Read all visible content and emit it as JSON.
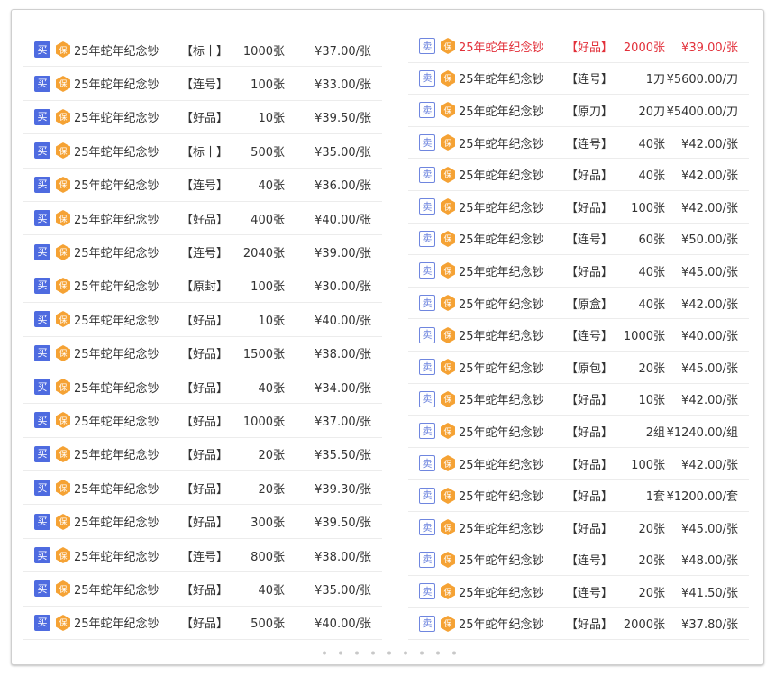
{
  "colors": {
    "buy_tag": "#4e6be0",
    "sell_tag": "#6f86df",
    "badge": "#f5a234",
    "highlight": "#e2303a"
  },
  "left_list": [
    {
      "tag": "买",
      "badge": "保",
      "name": "25年蛇年纪念钞",
      "cat": "【标十】",
      "qty": "1000张",
      "price": "¥37.00/张"
    },
    {
      "tag": "买",
      "badge": "保",
      "name": "25年蛇年纪念钞",
      "cat": "【连号】",
      "qty": "100张",
      "price": "¥33.00/张"
    },
    {
      "tag": "买",
      "badge": "保",
      "name": "25年蛇年纪念钞",
      "cat": "【好品】",
      "qty": "10张",
      "price": "¥39.50/张"
    },
    {
      "tag": "买",
      "badge": "保",
      "name": "25年蛇年纪念钞",
      "cat": "【标十】",
      "qty": "500张",
      "price": "¥35.00/张"
    },
    {
      "tag": "买",
      "badge": "保",
      "name": "25年蛇年纪念钞",
      "cat": "【连号】",
      "qty": "40张",
      "price": "¥36.00/张"
    },
    {
      "tag": "买",
      "badge": "保",
      "name": "25年蛇年纪念钞",
      "cat": "【好品】",
      "qty": "400张",
      "price": "¥40.00/张"
    },
    {
      "tag": "买",
      "badge": "保",
      "name": "25年蛇年纪念钞",
      "cat": "【连号】",
      "qty": "2040张",
      "price": "¥39.00/张"
    },
    {
      "tag": "买",
      "badge": "保",
      "name": "25年蛇年纪念钞",
      "cat": "【原封】",
      "qty": "100张",
      "price": "¥30.00/张"
    },
    {
      "tag": "买",
      "badge": "保",
      "name": "25年蛇年纪念钞",
      "cat": "【好品】",
      "qty": "10张",
      "price": "¥40.00/张"
    },
    {
      "tag": "买",
      "badge": "保",
      "name": "25年蛇年纪念钞",
      "cat": "【好品】",
      "qty": "1500张",
      "price": "¥38.00/张"
    },
    {
      "tag": "买",
      "badge": "保",
      "name": "25年蛇年纪念钞",
      "cat": "【好品】",
      "qty": "40张",
      "price": "¥34.00/张"
    },
    {
      "tag": "买",
      "badge": "保",
      "name": "25年蛇年纪念钞",
      "cat": "【好品】",
      "qty": "1000张",
      "price": "¥37.00/张"
    },
    {
      "tag": "买",
      "badge": "保",
      "name": "25年蛇年纪念钞",
      "cat": "【好品】",
      "qty": "20张",
      "price": "¥35.50/张"
    },
    {
      "tag": "买",
      "badge": "保",
      "name": "25年蛇年纪念钞",
      "cat": "【好品】",
      "qty": "20张",
      "price": "¥39.30/张"
    },
    {
      "tag": "买",
      "badge": "保",
      "name": "25年蛇年纪念钞",
      "cat": "【好品】",
      "qty": "300张",
      "price": "¥39.50/张"
    },
    {
      "tag": "买",
      "badge": "保",
      "name": "25年蛇年纪念钞",
      "cat": "【连号】",
      "qty": "800张",
      "price": "¥38.00/张"
    },
    {
      "tag": "买",
      "badge": "保",
      "name": "25年蛇年纪念钞",
      "cat": "【好品】",
      "qty": "40张",
      "price": "¥35.00/张"
    },
    {
      "tag": "买",
      "badge": "保",
      "name": "25年蛇年纪念钞",
      "cat": "【好品】",
      "qty": "500张",
      "price": "¥40.00/张"
    }
  ],
  "right_list": [
    {
      "tag": "卖",
      "badge": "保",
      "name": "25年蛇年纪念钞",
      "cat": "【好品】",
      "qty": "2000张",
      "price": "¥39.00/张",
      "highlight": true
    },
    {
      "tag": "卖",
      "badge": "保",
      "name": "25年蛇年纪念钞",
      "cat": "【连号】",
      "qty": "1刀",
      "price": "¥5600.00/刀"
    },
    {
      "tag": "卖",
      "badge": "保",
      "name": "25年蛇年纪念钞",
      "cat": "【原刀】",
      "qty": "20刀",
      "price": "¥5400.00/刀"
    },
    {
      "tag": "卖",
      "badge": "保",
      "name": "25年蛇年纪念钞",
      "cat": "【连号】",
      "qty": "40张",
      "price": "¥42.00/张"
    },
    {
      "tag": "卖",
      "badge": "保",
      "name": "25年蛇年纪念钞",
      "cat": "【好品】",
      "qty": "40张",
      "price": "¥42.00/张"
    },
    {
      "tag": "卖",
      "badge": "保",
      "name": "25年蛇年纪念钞",
      "cat": "【好品】",
      "qty": "100张",
      "price": "¥42.00/张"
    },
    {
      "tag": "卖",
      "badge": "保",
      "name": "25年蛇年纪念钞",
      "cat": "【连号】",
      "qty": "60张",
      "price": "¥50.00/张"
    },
    {
      "tag": "卖",
      "badge": "保",
      "name": "25年蛇年纪念钞",
      "cat": "【好品】",
      "qty": "40张",
      "price": "¥45.00/张"
    },
    {
      "tag": "卖",
      "badge": "保",
      "name": "25年蛇年纪念钞",
      "cat": "【原盒】",
      "qty": "40张",
      "price": "¥42.00/张"
    },
    {
      "tag": "卖",
      "badge": "保",
      "name": "25年蛇年纪念钞",
      "cat": "【连号】",
      "qty": "1000张",
      "price": "¥40.00/张"
    },
    {
      "tag": "卖",
      "badge": "保",
      "name": "25年蛇年纪念钞",
      "cat": "【原包】",
      "qty": "20张",
      "price": "¥45.00/张"
    },
    {
      "tag": "卖",
      "badge": "保",
      "name": "25年蛇年纪念钞",
      "cat": "【好品】",
      "qty": "10张",
      "price": "¥42.00/张"
    },
    {
      "tag": "卖",
      "badge": "保",
      "name": "25年蛇年纪念钞",
      "cat": "【好品】",
      "qty": "2组",
      "price": "¥1240.00/组"
    },
    {
      "tag": "卖",
      "badge": "保",
      "name": "25年蛇年纪念钞",
      "cat": "【好品】",
      "qty": "100张",
      "price": "¥42.00/张"
    },
    {
      "tag": "卖",
      "badge": "保",
      "name": "25年蛇年纪念钞",
      "cat": "【好品】",
      "qty": "1套",
      "price": "¥1200.00/套"
    },
    {
      "tag": "卖",
      "badge": "保",
      "name": "25年蛇年纪念钞",
      "cat": "【好品】",
      "qty": "20张",
      "price": "¥45.00/张"
    },
    {
      "tag": "卖",
      "badge": "保",
      "name": "25年蛇年纪念钞",
      "cat": "【连号】",
      "qty": "20张",
      "price": "¥48.00/张"
    },
    {
      "tag": "卖",
      "badge": "保",
      "name": "25年蛇年纪念钞",
      "cat": "【连号】",
      "qty": "20张",
      "price": "¥41.50/张"
    },
    {
      "tag": "卖",
      "badge": "保",
      "name": "25年蛇年纪念钞",
      "cat": "【好品】",
      "qty": "2000张",
      "price": "¥37.80/张"
    }
  ]
}
